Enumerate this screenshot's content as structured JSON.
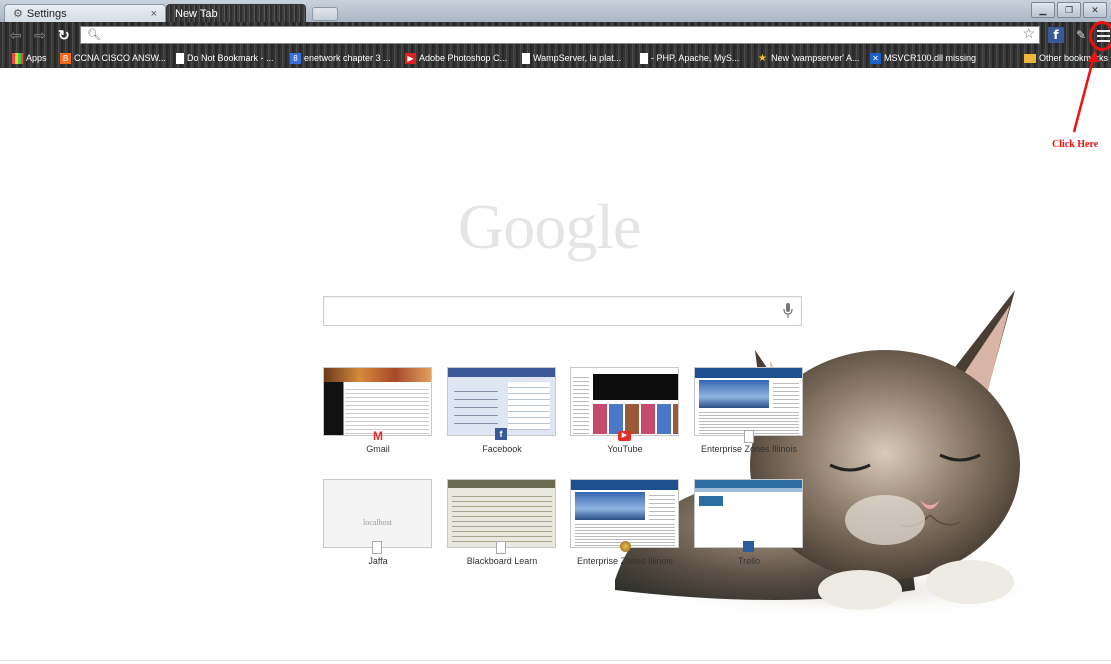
{
  "tabs": [
    {
      "label": "Settings",
      "icon": "gear-icon"
    },
    {
      "label": "New Tab"
    }
  ],
  "window_controls": [
    "minimize",
    "maximize",
    "close"
  ],
  "bookmarks": [
    {
      "label": "Apps",
      "icon": "apps-icon"
    },
    {
      "label": "CCNA CISCO ANSW...",
      "icon": "blogger-icon"
    },
    {
      "label": "Do Not Bookmark - ...",
      "icon": "page-icon"
    },
    {
      "label": "enetwork chapter 3 ...",
      "icon": "google-icon"
    },
    {
      "label": "Adobe Photoshop C...",
      "icon": "youtube-icon"
    },
    {
      "label": "WampServer, la plat...",
      "icon": "page-icon"
    },
    {
      "label": "- PHP, Apache, MyS...",
      "icon": "page-icon"
    },
    {
      "label": "New 'wampserver' A...",
      "icon": "star-icon"
    },
    {
      "label": "MSVCR100.dll missing",
      "icon": "x-icon"
    },
    {
      "label": "Other bookmarks",
      "icon": "folder-icon"
    }
  ],
  "annotation": {
    "label": "Click Here",
    "color": "#e11111"
  },
  "logo": "Google",
  "tiles": [
    {
      "label": "Gmail",
      "favicon": "gmail-icon"
    },
    {
      "label": "Facebook",
      "favicon": "facebook-icon"
    },
    {
      "label": "YouTube",
      "favicon": "youtube-icon"
    },
    {
      "label": "Enterprise Zones Illinois",
      "favicon": "page-icon"
    },
    {
      "label": "Jaffa",
      "favicon": "page-icon",
      "thumb_text": "localhost"
    },
    {
      "label": "Blackboard Learn",
      "favicon": "page-icon"
    },
    {
      "label": "Enterprise Zones Illinois",
      "favicon": "seal-icon"
    },
    {
      "label": "Trello",
      "favicon": "trello-icon"
    }
  ]
}
